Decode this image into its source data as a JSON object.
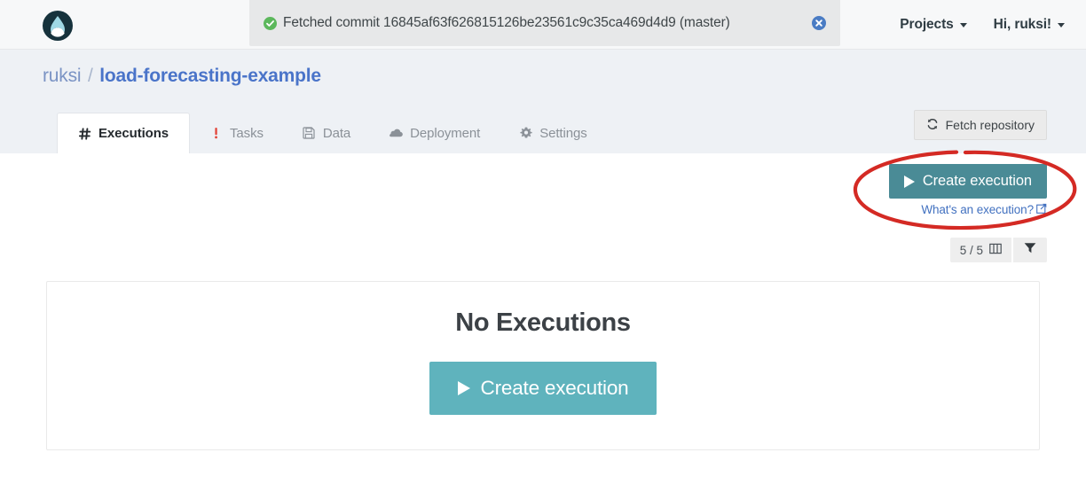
{
  "topnav": {
    "logo_icon": "peltarion-drop-logo-icon",
    "flash": {
      "status_icon": "check-circle-icon",
      "message": "Fetched commit 16845af63f626815126be23561c9c35ca469d4d9 (master)",
      "close_icon": "close-circle-icon"
    },
    "menus": [
      {
        "label": "Projects",
        "icon": "chevron-down-icon"
      },
      {
        "label": "Hi, ruksi!",
        "icon": "chevron-down-icon"
      }
    ]
  },
  "breadcrumb": {
    "owner": "ruksi",
    "separator": "/",
    "project": "load-forecasting-example"
  },
  "tabs": [
    {
      "label": "Executions",
      "icon": "hash-icon",
      "active": true
    },
    {
      "label": "Tasks",
      "icon": "exclamation-icon",
      "active": false
    },
    {
      "label": "Data",
      "icon": "floppy-disk-icon",
      "active": false
    },
    {
      "label": "Deployment",
      "icon": "cloud-icon",
      "active": false
    },
    {
      "label": "Settings",
      "icon": "gear-icon",
      "active": false
    }
  ],
  "toolbar": {
    "fetch_repository_label": "Fetch repository",
    "fetch_repository_icon": "refresh-sync-icon",
    "create_execution_label": "Create execution",
    "create_execution_icon": "play-icon",
    "whats_an_execution_label": "What's an execution?",
    "whats_an_execution_icon": "external-link-icon",
    "counter_label": "5 / 5",
    "columns_icon": "columns-icon",
    "filter_icon": "funnel-filter-icon"
  },
  "empty_state": {
    "title": "No Executions",
    "create_execution_label": "Create execution",
    "create_execution_icon": "play-icon"
  },
  "annotation": {
    "shape": "ellipse-highlight",
    "color": "#d42a24",
    "target": "create-execution-button"
  },
  "colors": {
    "teal_dark": "#4a8b96",
    "teal_light": "#5fb3bd",
    "link_blue": "#4271c0",
    "project_blue": "#4a74c9",
    "band_bg": "#eef1f5",
    "flash_bg": "#e7e8e9",
    "annotation_red": "#d42a24"
  }
}
